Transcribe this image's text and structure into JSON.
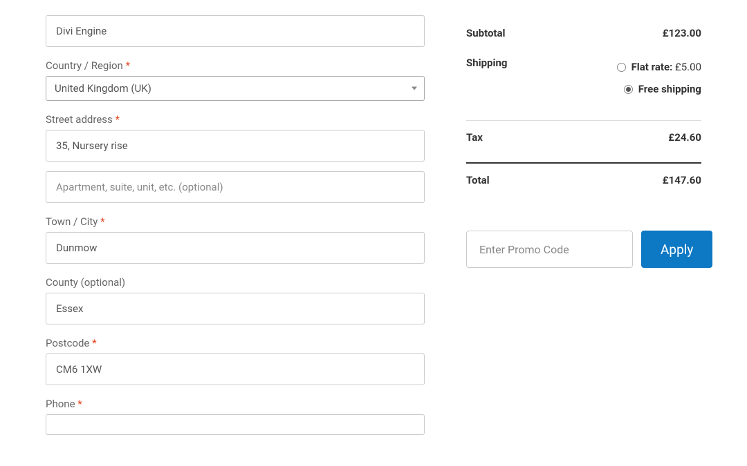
{
  "billing": {
    "company_value": "Divi Engine",
    "country_label": "Country / Region",
    "country_value": "United Kingdom (UK)",
    "street_label": "Street address",
    "street1_value": "35, Nursery rise",
    "street2_placeholder": "Apartment, suite, unit, etc. (optional)",
    "city_label": "Town / City",
    "city_value": "Dunmow",
    "county_label": "County (optional)",
    "county_value": "Essex",
    "postcode_label": "Postcode",
    "postcode_value": "CM6 1XW",
    "phone_label": "Phone",
    "required_mark": "*"
  },
  "summary": {
    "subtotal_label": "Subtotal",
    "subtotal_value": "£123.00",
    "shipping_label": "Shipping",
    "shipping_flat_label": "Flat rate:",
    "shipping_flat_price": "£5.00",
    "shipping_free_label": "Free shipping",
    "shipping_selected": "free",
    "tax_label": "Tax",
    "tax_value": "£24.60",
    "total_label": "Total",
    "total_value": "£147.60"
  },
  "promo": {
    "placeholder": "Enter Promo Code",
    "apply_label": "Apply"
  }
}
